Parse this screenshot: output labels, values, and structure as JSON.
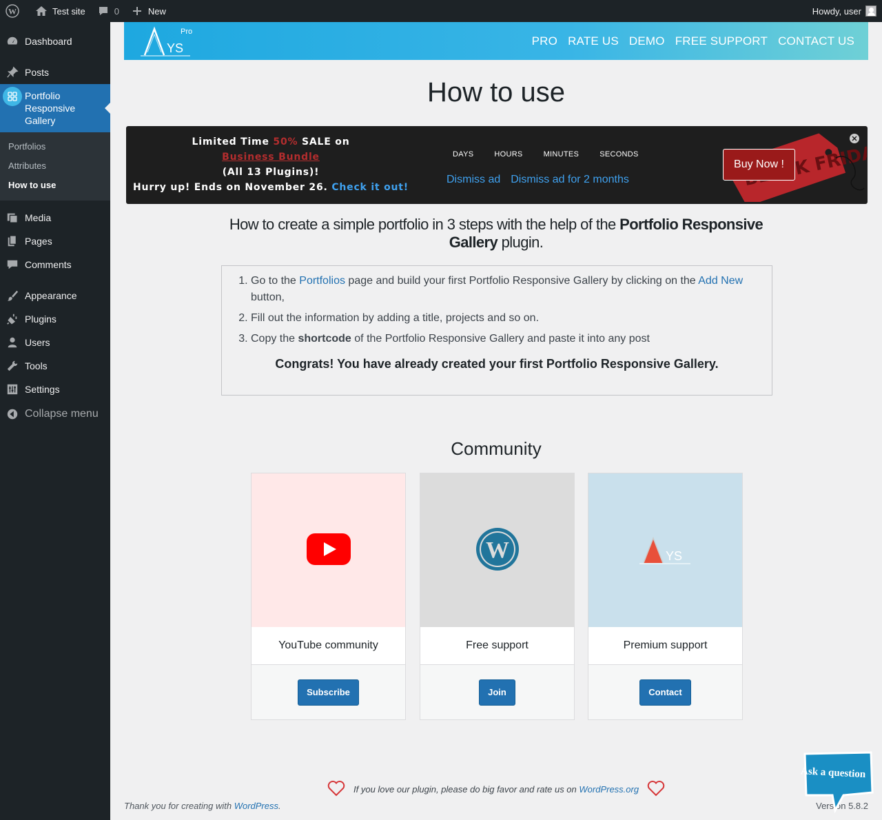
{
  "adminbar": {
    "site_name": "Test site",
    "comments_count": "0",
    "new_label": "New",
    "howdy": "Howdy, user"
  },
  "sidebar": {
    "items": [
      {
        "label": "Dashboard",
        "icon": "dashboard-icon"
      },
      {
        "label": "Posts",
        "icon": "pin-icon"
      },
      {
        "label": "Portfolio Responsive Gallery",
        "icon": "gallery-icon"
      },
      {
        "label": "Media",
        "icon": "media-icon"
      },
      {
        "label": "Pages",
        "icon": "pages-icon"
      },
      {
        "label": "Comments",
        "icon": "comment-icon"
      },
      {
        "label": "Appearance",
        "icon": "brush-icon"
      },
      {
        "label": "Plugins",
        "icon": "plugin-icon"
      },
      {
        "label": "Users",
        "icon": "user-icon"
      },
      {
        "label": "Tools",
        "icon": "wrench-icon"
      },
      {
        "label": "Settings",
        "icon": "sliders-icon"
      }
    ],
    "submenu": [
      "Portfolios",
      "Attributes",
      "How to use"
    ],
    "collapse": "Collapse menu"
  },
  "header": {
    "logo_badge": "Pro",
    "nav": [
      "PRO",
      "RATE US",
      "DEMO",
      "FREE SUPPORT",
      "CONTACT US"
    ]
  },
  "page_title": "How to use",
  "sale": {
    "line1_a": "Limited Time ",
    "line1_pct": "50%",
    "line1_b": " SALE on",
    "bundle": "Business Bundle",
    "line3": "(All 13 Plugins)!",
    "line4": "Hurry up! Ends on November 26. ",
    "check": "Check it out!",
    "countdown": [
      "DAYS",
      "HOURS",
      "MINUTES",
      "SECONDS"
    ],
    "dismiss": "Dismiss ad",
    "dismiss_2m": "Dismiss ad for 2 months",
    "buy": "Buy Now !",
    "tag_text": "BLACK FRIDAY"
  },
  "howto": {
    "heading_a": "How to create a simple portfolio in 3 steps with the help of the ",
    "heading_bold": "Portfolio Responsive Gallery",
    "heading_b": " plugin.",
    "step1_a": "Go to the ",
    "step1_link": "Portfolios",
    "step1_b": " page and build your first Portfolio Responsive Gallery by clicking on the ",
    "step1_link2": "Add New",
    "step1_c": " button,",
    "step2": "Fill out the information by adding a title, projects and so on.",
    "step3_a": "Copy the ",
    "step3_bold": "shortcode",
    "step3_b": " of the Portfolio Responsive Gallery and paste it into any post⁠",
    "congrats": "Congrats! You have already created your first Portfolio Responsive Gallery."
  },
  "community": {
    "title": "Community",
    "cards": [
      {
        "title": "YouTube community",
        "button": "Subscribe",
        "bg": "#ffe8e8"
      },
      {
        "title": "Free support",
        "button": "Join",
        "bg": "#dcdcdc"
      },
      {
        "title": "Premium support",
        "button": "Contact",
        "bg": "#c9e0ec"
      }
    ]
  },
  "footer": {
    "rate_text": "If you love our plugin, please do big favor and rate us on ",
    "rate_link": "WordPress.org",
    "thanks": "Thank you for creating with ",
    "thanks_link": "WordPress",
    "version": "Version 5.8.2",
    "ask": "Ask a question"
  },
  "colors": {
    "accent": "#2271b1",
    "sidebar": "#1d2327",
    "sale": "#b32d2e"
  }
}
